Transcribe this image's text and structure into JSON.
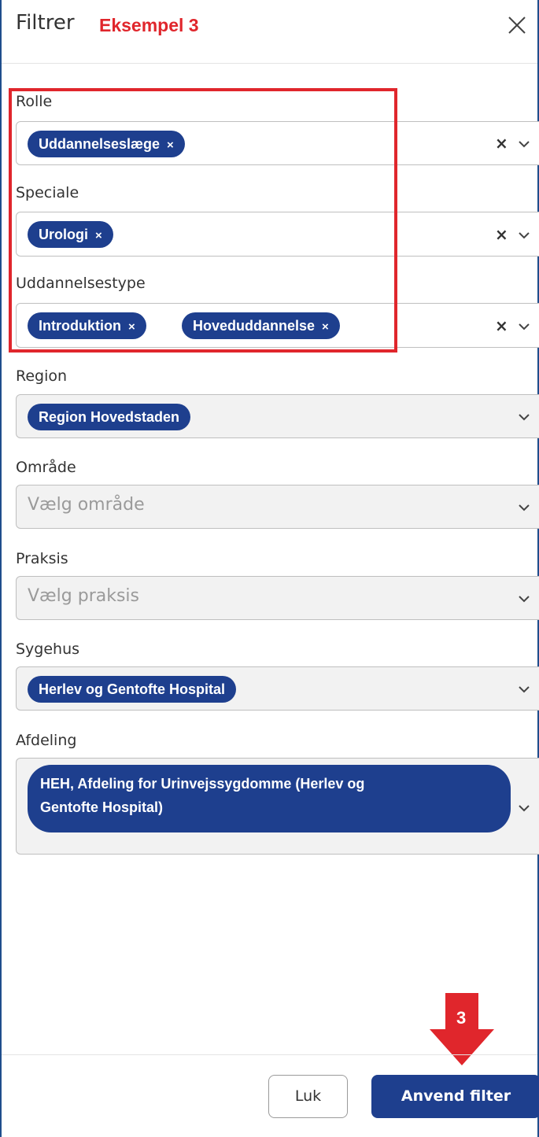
{
  "header": {
    "title": "Filtrer",
    "annotation": "Eksempel 3"
  },
  "filters": {
    "rolle": {
      "label": "Rolle",
      "chips": [
        "Uddannelseslæge"
      ],
      "clear": "×"
    },
    "speciale": {
      "label": "Speciale",
      "chips": [
        "Urologi"
      ],
      "clear": "×"
    },
    "uddannelsestype": {
      "label": "Uddannelsestype",
      "chips": [
        "Introduktion",
        "Hoveduddannelse"
      ],
      "clear": "×"
    },
    "region": {
      "label": "Region",
      "chips": [
        "Region Hovedstaden"
      ]
    },
    "omraade": {
      "label": "Område",
      "placeholder": "Vælg område"
    },
    "praksis": {
      "label": "Praksis",
      "placeholder": "Vælg praksis"
    },
    "sygehus": {
      "label": "Sygehus",
      "chips": [
        "Herlev og Gentofte Hospital"
      ]
    },
    "afdeling": {
      "label": "Afdeling",
      "chip_line1": "HEH, Afdeling for Urinvejssygdomme (Herlev og",
      "chip_line2": "Gentofte Hospital)"
    }
  },
  "chip_remove_glyph": "×",
  "footer": {
    "close_label": "Luk",
    "apply_label": "Anvend filter",
    "step_number": "3"
  },
  "colors": {
    "accent": "#1e3f8e",
    "annotation_red": "#e0262c"
  },
  "icons": [
    "close-icon",
    "chevron-down-icon",
    "arrow-down-icon"
  ]
}
